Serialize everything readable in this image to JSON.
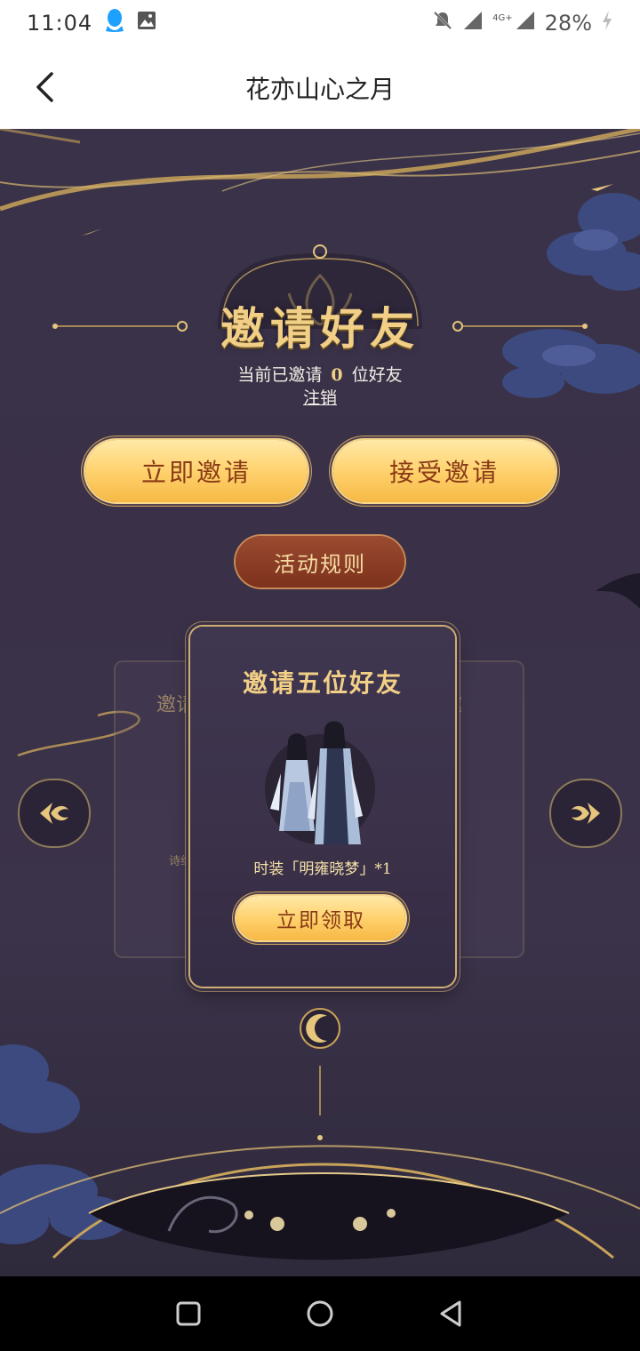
{
  "status_bar": {
    "time": "11:04",
    "battery": "28%",
    "network": "4G+",
    "icons": [
      "qq-icon",
      "image-icon",
      "mute-icon",
      "signal-icon",
      "battery-icon"
    ]
  },
  "header": {
    "title": "花亦山心之月",
    "back_icon": "chevron-left-icon"
  },
  "invite": {
    "title": "邀请好友",
    "invited_prefix": "当前已邀请",
    "invited_count": "0",
    "invited_suffix": "位好友",
    "logout_label": "注销",
    "invite_now_label": "立即邀请",
    "accept_invite_label": "接受邀请",
    "rules_label": "活动规则"
  },
  "rewards": {
    "active_card": {
      "title": "邀请五位好友",
      "reward_name": "时装「明雍晓梦」*1",
      "claim_label": "立即领取"
    },
    "left_card": {
      "title_fragment": "邀请",
      "text_fragment": "诗约"
    },
    "right_card": {
      "title_fragment": "邀"
    }
  },
  "colors": {
    "background": "#3a3148",
    "gold_text": "#f2cf86",
    "button_gold": "#ffd26e",
    "button_text": "#8a3b16",
    "rules_button": "#8a3d25"
  },
  "nav_bar": {
    "icons": [
      "recent-apps-icon",
      "home-icon",
      "back-icon"
    ]
  }
}
